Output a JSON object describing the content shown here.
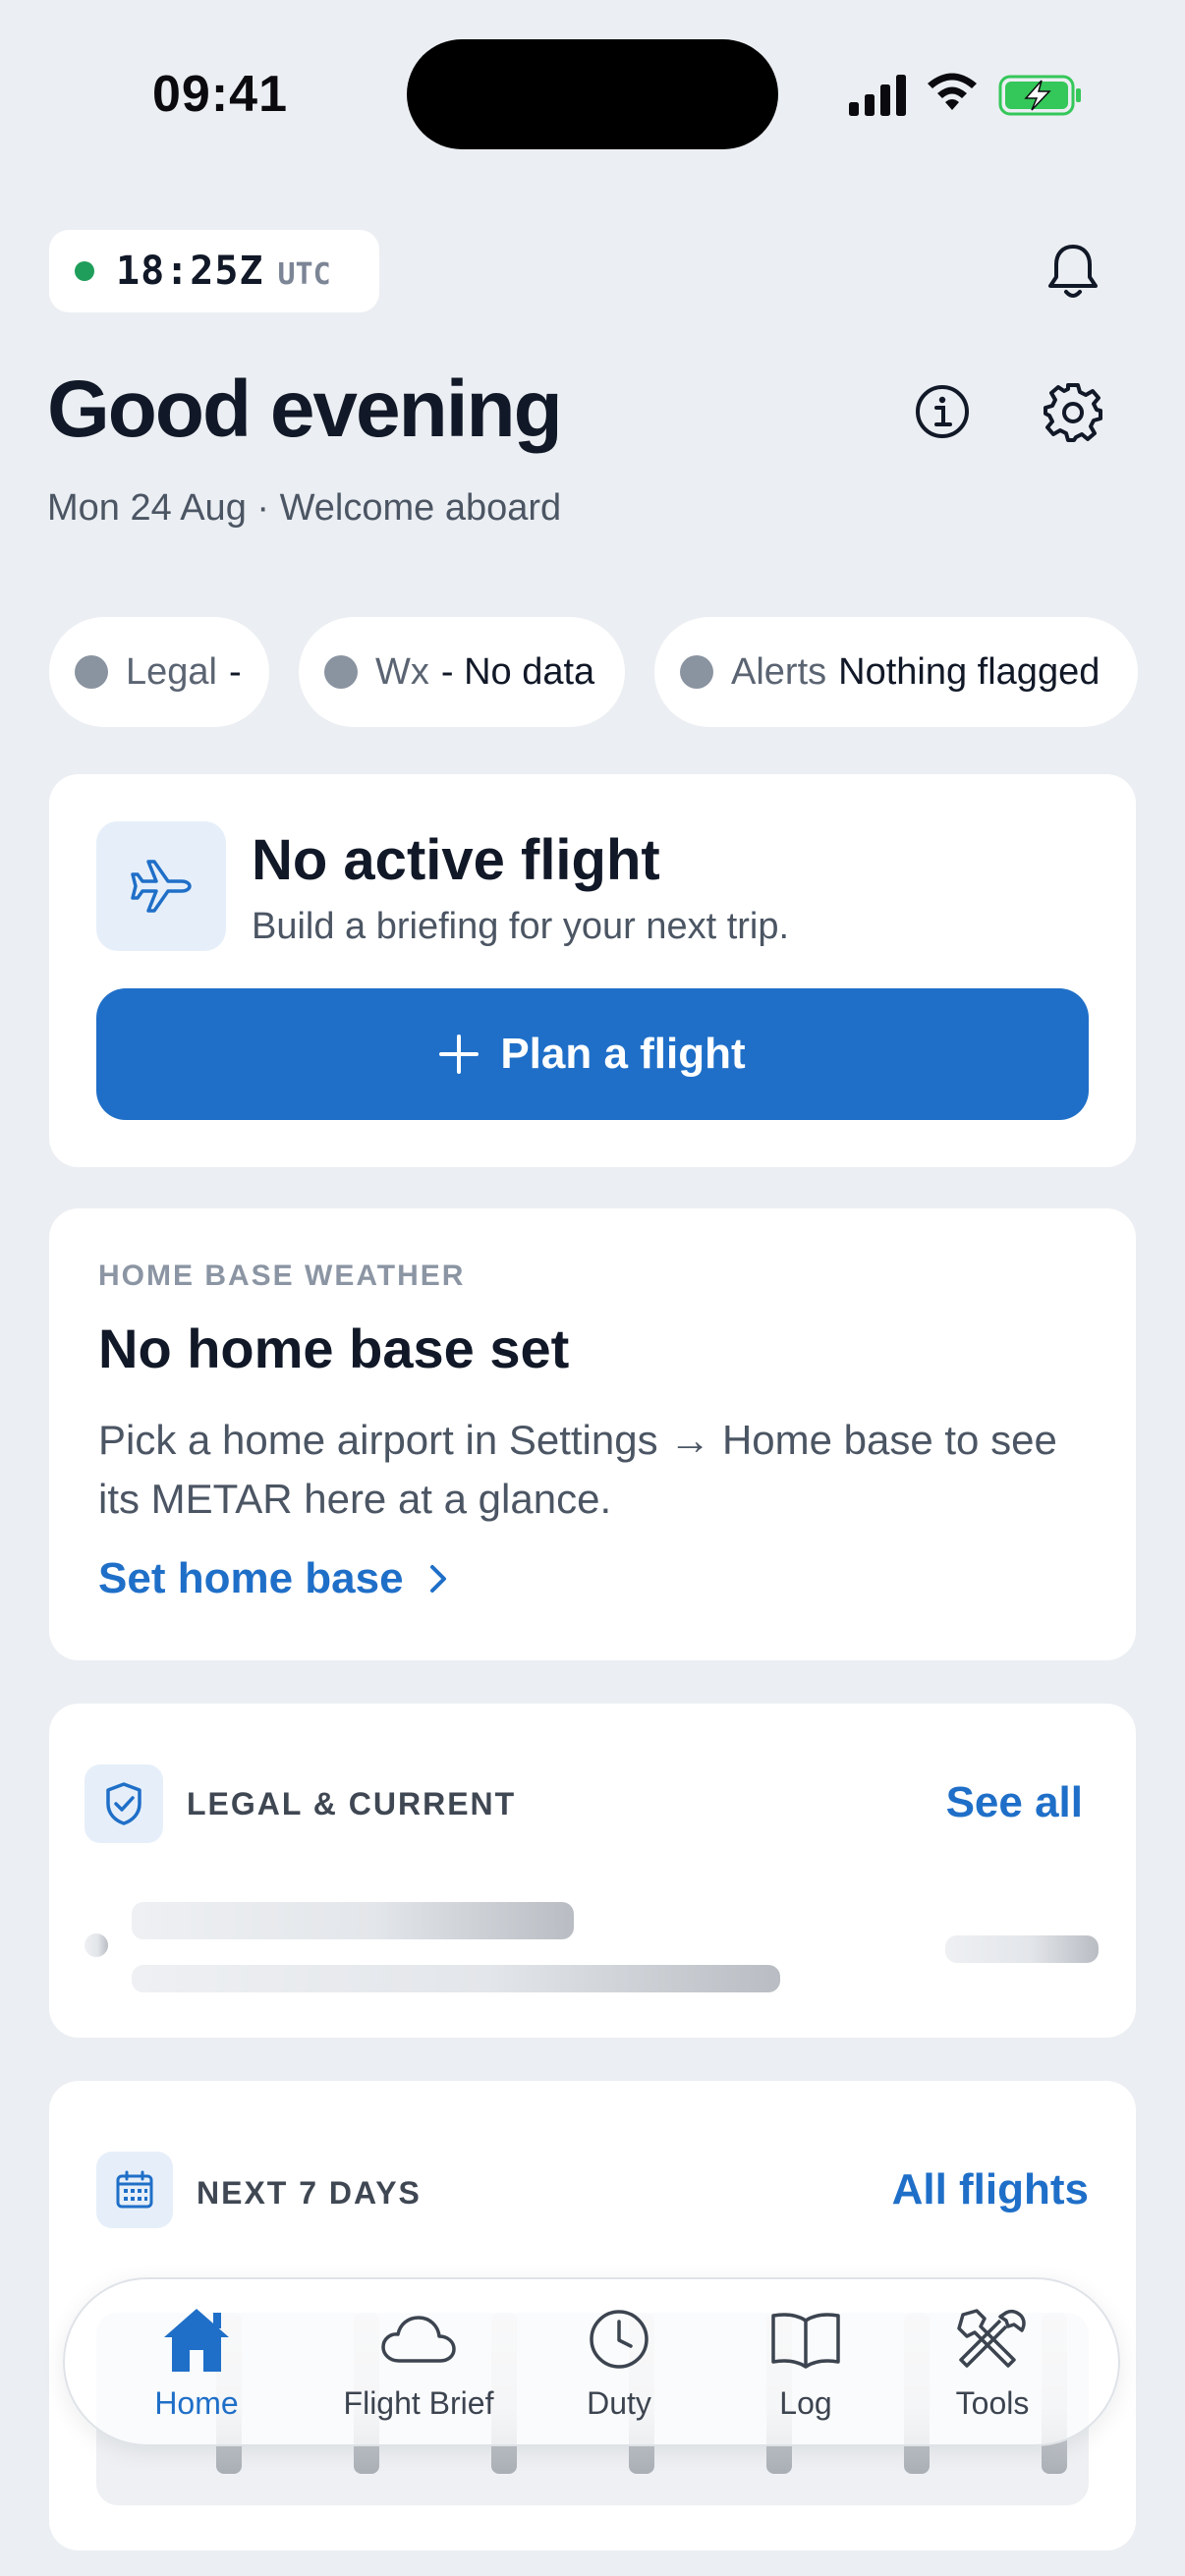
{
  "status_bar": {
    "time": "09:41"
  },
  "header": {
    "utc_time": "18:25Z",
    "utc_label": "UTC",
    "greeting": "Good evening",
    "date": "Mon 24 Aug",
    "separator": "·",
    "welcome": "Welcome aboard"
  },
  "chips": [
    {
      "label": "Legal",
      "value": "-"
    },
    {
      "label": "Wx",
      "value": "- No data"
    },
    {
      "label": "Alerts",
      "value": "Nothing flagged"
    }
  ],
  "active_flight": {
    "title": "No active flight",
    "subtitle": "Build a briefing for your next trip.",
    "button_label": "Plan a flight"
  },
  "home_weather": {
    "eyebrow": "HOME BASE WEATHER",
    "title": "No home base set",
    "body": "Pick a home airport in Settings → Home base to see its METAR here at a glance.",
    "link": "Set home base"
  },
  "legal_current": {
    "heading": "LEGAL & CURRENT",
    "link": "See all"
  },
  "next_days": {
    "heading": "NEXT 7 DAYS",
    "link": "All flights"
  },
  "tab_bar": {
    "tabs": [
      {
        "label": "Home",
        "icon": "home-icon",
        "active": true
      },
      {
        "label": "Flight Brief",
        "icon": "cloud-icon",
        "active": false
      },
      {
        "label": "Duty",
        "icon": "clock-icon",
        "active": false
      },
      {
        "label": "Log",
        "icon": "book-icon",
        "active": false
      },
      {
        "label": "Tools",
        "icon": "tools-icon",
        "active": false
      }
    ]
  },
  "colors": {
    "accent": "#1F6FC8",
    "background": "#EBEEF2",
    "utc_dot": "#1E9E5A",
    "chip_dot": "#8A93A0"
  }
}
